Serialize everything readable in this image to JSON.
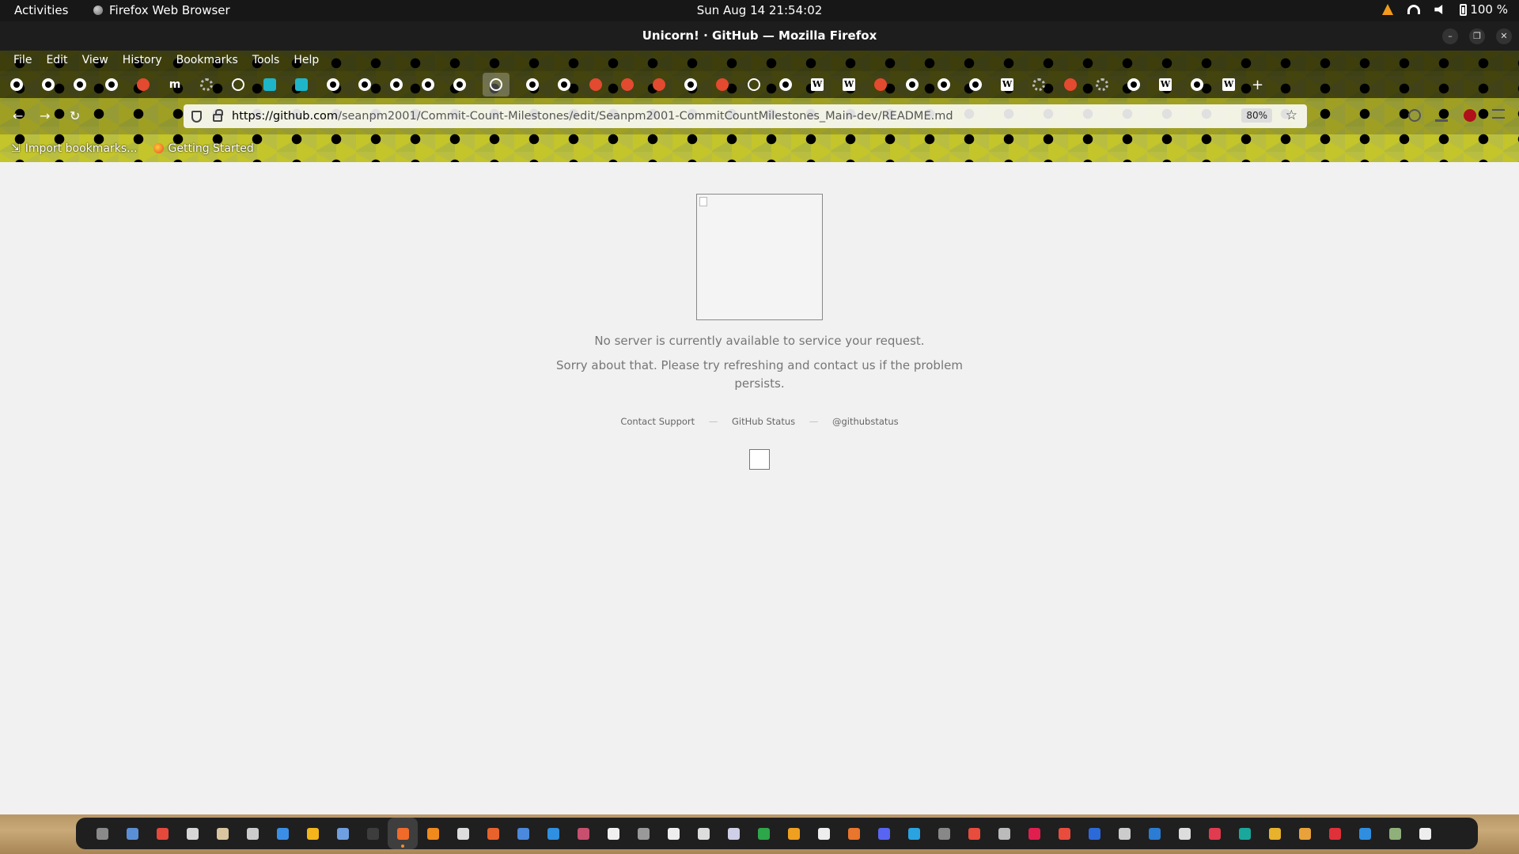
{
  "topbar": {
    "activities": "Activities",
    "app_name": "Firefox Web Browser",
    "clock": "Sun Aug 14  21:54:02",
    "battery": "100 %"
  },
  "window": {
    "title": "Unicorn! · GitHub — Mozilla Firefox"
  },
  "menubar": [
    "File",
    "Edit",
    "View",
    "History",
    "Bookmarks",
    "Tools",
    "Help"
  ],
  "tabs": [
    {
      "icon": "github-icon",
      "kind": "gh"
    },
    {
      "icon": "github-icon",
      "kind": "gh"
    },
    {
      "icon": "github-icon",
      "kind": "gh"
    },
    {
      "icon": "github-icon",
      "kind": "gh"
    },
    {
      "icon": "pocket-icon",
      "kind": "red"
    },
    {
      "icon": "m-icon",
      "kind": "m"
    },
    {
      "icon": "gear-icon",
      "kind": "gear"
    },
    {
      "icon": "document-icon",
      "kind": "glob"
    },
    {
      "icon": "bug-icon",
      "kind": "cyan"
    },
    {
      "icon": "bug-icon",
      "kind": "cyan"
    },
    {
      "icon": "github-icon",
      "kind": "gh"
    },
    {
      "icon": "github-icon",
      "kind": "gh"
    },
    {
      "icon": "github-icon",
      "kind": "gh"
    },
    {
      "icon": "github-icon",
      "kind": "gh"
    },
    {
      "icon": "github-icon",
      "kind": "gh"
    },
    {
      "icon": "globe-icon",
      "kind": "glob",
      "active": true
    },
    {
      "icon": "github-icon",
      "kind": "gh"
    },
    {
      "icon": "github-icon",
      "kind": "gh"
    },
    {
      "icon": "reddit-icon",
      "kind": "red"
    },
    {
      "icon": "reddit-icon",
      "kind": "red"
    },
    {
      "icon": "reddit-icon",
      "kind": "red"
    },
    {
      "icon": "github-icon",
      "kind": "gh"
    },
    {
      "icon": "reddit-icon",
      "kind": "red"
    },
    {
      "icon": "globe-icon",
      "kind": "glob"
    },
    {
      "icon": "github-icon",
      "kind": "gh"
    },
    {
      "icon": "wikipedia-icon",
      "kind": "w"
    },
    {
      "icon": "wikipedia-icon",
      "kind": "w"
    },
    {
      "icon": "reddit-icon",
      "kind": "red"
    },
    {
      "icon": "github-icon",
      "kind": "gh"
    },
    {
      "icon": "github-icon",
      "kind": "gh"
    },
    {
      "icon": "github-icon",
      "kind": "gh"
    },
    {
      "icon": "wikipedia-icon",
      "kind": "w"
    },
    {
      "icon": "openai-icon",
      "kind": "gear"
    },
    {
      "icon": "reddit-icon",
      "kind": "red"
    },
    {
      "icon": "openai-icon",
      "kind": "gear"
    },
    {
      "icon": "github-icon",
      "kind": "gh"
    },
    {
      "icon": "wikipedia-icon",
      "kind": "w"
    },
    {
      "icon": "github-icon",
      "kind": "gh"
    },
    {
      "icon": "wikipedia-icon",
      "kind": "w"
    }
  ],
  "urlbar": {
    "url_host": "https://github.com",
    "url_path": "/seanpm2001/Commit-Count-Milestones/edit/Seanpm2001-CommitCountMilestones_Main-dev/README.md",
    "zoom": "80%"
  },
  "bookmarks": {
    "import": "Import bookmarks...",
    "getting_started": "Getting Started"
  },
  "page": {
    "line1": "No server is currently available to service your request.",
    "line2": "Sorry about that. Please try refreshing and contact us if the problem",
    "line3": "persists.",
    "links": {
      "support": "Contact Support",
      "status": "GitHub Status",
      "twitter": "@githubstatus",
      "separator": "—"
    }
  },
  "dock": [
    {
      "name": "files-app",
      "color": "#8a8a8a"
    },
    {
      "name": "file-manager",
      "color": "#5a8fd6"
    },
    {
      "name": "chrome",
      "color": "#e4493b"
    },
    {
      "name": "notes",
      "color": "#d7d7d7"
    },
    {
      "name": "archive",
      "color": "#d9c6a0"
    },
    {
      "name": "screenshot",
      "color": "#cccccc"
    },
    {
      "name": "writer",
      "color": "#3a8ee6"
    },
    {
      "name": "calc-sheet",
      "color": "#f3b51b"
    },
    {
      "name": "text-editor",
      "color": "#6f9fe0"
    },
    {
      "name": "terminal",
      "color": "#3d3d3d"
    },
    {
      "name": "firefox",
      "color": "#f06b2a",
      "active": true
    },
    {
      "name": "vlc",
      "color": "#f08a1c"
    },
    {
      "name": "obs",
      "color": "#dddddd"
    },
    {
      "name": "software",
      "color": "#e8622c"
    },
    {
      "name": "calendar",
      "color": "#4a89dc"
    },
    {
      "name": "help",
      "color": "#2f8fe0"
    },
    {
      "name": "monitor",
      "color": "#c84f6e"
    },
    {
      "name": "camera",
      "color": "#f0f0f0"
    },
    {
      "name": "ink",
      "color": "#999999"
    },
    {
      "name": "inkscape",
      "color": "#eeeeee"
    },
    {
      "name": "cube",
      "color": "#dddddd"
    },
    {
      "name": "disk",
      "color": "#cfcfe8"
    },
    {
      "name": "spreadsheet",
      "color": "#2ea64a"
    },
    {
      "name": "slides",
      "color": "#f0a020"
    },
    {
      "name": "draw",
      "color": "#eeeeee"
    },
    {
      "name": "impress",
      "color": "#e8762c"
    },
    {
      "name": "discord",
      "color": "#5865f2"
    },
    {
      "name": "telegram",
      "color": "#2aa3e0"
    },
    {
      "name": "steam",
      "color": "#888888"
    },
    {
      "name": "pdf",
      "color": "#e84c3d"
    },
    {
      "name": "percent",
      "color": "#bbbbbb"
    },
    {
      "name": "record",
      "color": "#e01f4f"
    },
    {
      "name": "gift",
      "color": "#e84c3d"
    },
    {
      "name": "word",
      "color": "#2b6ad8"
    },
    {
      "name": "steam-dark",
      "color": "#cccccc"
    },
    {
      "name": "outlook",
      "color": "#2b7cd3"
    },
    {
      "name": "github-desktop",
      "color": "#dddddd"
    },
    {
      "name": "heart-app",
      "color": "#e13b4f"
    },
    {
      "name": "teal-app",
      "color": "#1aa89c"
    },
    {
      "name": "lens",
      "color": "#e8b22c"
    },
    {
      "name": "chat",
      "color": "#e9a23a"
    },
    {
      "name": "red-app",
      "color": "#e0303a"
    },
    {
      "name": "vscode",
      "color": "#2f8ee0"
    },
    {
      "name": "trash",
      "color": "#8fb07a"
    },
    {
      "name": "app-grid",
      "color": "#eeeeee"
    }
  ]
}
